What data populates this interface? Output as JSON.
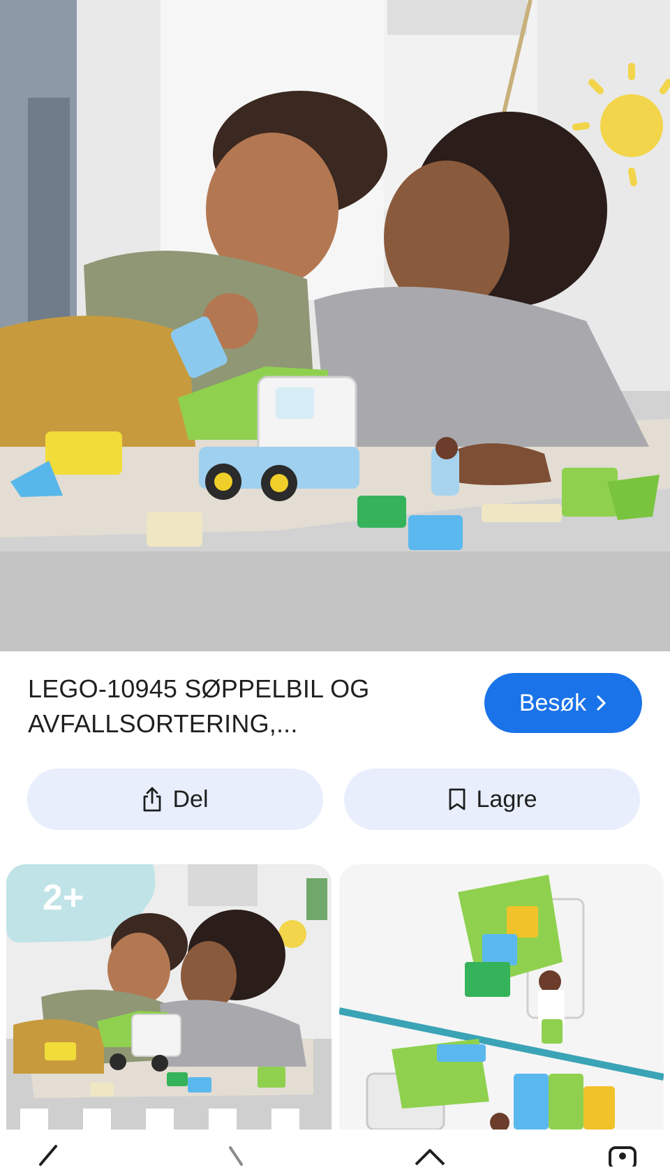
{
  "product": {
    "title": "LEGO-10945 SØPPELBIL OG\nAVFALLSORTERING,..."
  },
  "actions": {
    "visit_label": "Besøk",
    "share_label": "Del",
    "save_label": "Lagre"
  },
  "thumbnails": [
    {
      "badge": "2+",
      "subject": "child and mother playing with LEGO truck"
    },
    {
      "subject": "LEGO DUPLO garbage truck set"
    }
  ],
  "icons": {
    "visit": "chevron-right-icon",
    "share": "share-icon",
    "save": "bookmark-icon",
    "nav": [
      "back-icon",
      "recent-icon",
      "home-icon",
      "assistant-icon"
    ]
  },
  "colors": {
    "accent": "#1a73e8",
    "pill_bg": "#e8eefc",
    "text": "#1f1f1f"
  }
}
